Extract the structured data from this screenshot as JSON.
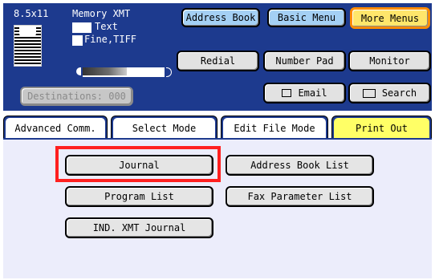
{
  "status": {
    "paper": "8.5x11",
    "mode": "Memory XMT",
    "orig_type": "Text",
    "resolution": "Fine,TIFF",
    "density_level": 0.55,
    "destinations": "Destinations: 000"
  },
  "top_buttons": {
    "address_book": "Address Book",
    "basic_menu": "Basic Menu",
    "more_menus": "More Menus",
    "redial": "Redial",
    "number_pad": "Number Pad",
    "monitor": "Monitor",
    "email": "Email",
    "search": "Search"
  },
  "tabs": [
    {
      "label": "Advanced Comm.",
      "active": false
    },
    {
      "label": "Select Mode",
      "active": false
    },
    {
      "label": "Edit File Mode",
      "active": false
    },
    {
      "label": "Print Out",
      "active": true
    }
  ],
  "content_buttons": {
    "journal": "Journal",
    "address_book_list": "Address Book List",
    "program_list": "Program List",
    "fax_parameter_list": "Fax Parameter List",
    "ind_xmt_journal": "IND. XMT Journal"
  },
  "colors": {
    "header_bg": "#1d3a8e",
    "button_blue": "#a4d0f4",
    "button_yellow": "#ffe66b",
    "highlight_red": "#ff2020",
    "panel_bg": "#ecedfb"
  }
}
